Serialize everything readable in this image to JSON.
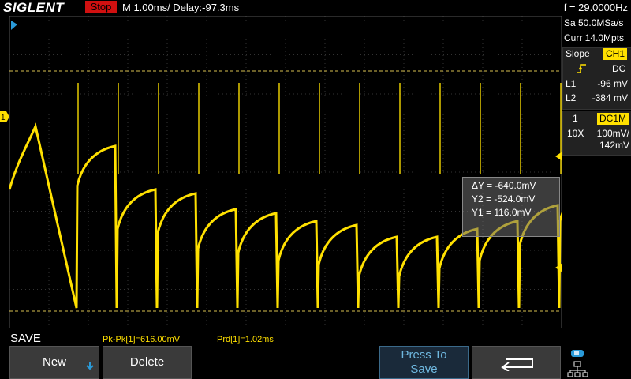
{
  "header": {
    "brand": "SIGLENT",
    "run_state": "Stop",
    "timebase": "M 1.00ms/ Delay:-97.3ms",
    "frequency": "f = 29.0000Hz"
  },
  "acquisition": {
    "sample_rate": "Sa 50.0MSa/s",
    "memory": "Curr 14.0Mpts"
  },
  "trigger": {
    "slope_label": "Slope",
    "source": "CH1",
    "coupling": "DC",
    "l1_label": "L1",
    "l1_value": "-96 mV",
    "l2_label": "L2",
    "l2_value": "-384 mV"
  },
  "channel": {
    "number": "1",
    "coupling_impedance": "DC1M",
    "probe": "10X",
    "volts_per_div": "100mV/",
    "offset": "142mV"
  },
  "cursors": {
    "delta_y": "ΔY = -640.0mV",
    "y2": "Y2 = -524.0mV",
    "y1": "Y1 = 116.0mV"
  },
  "measurements": {
    "pkpk": "Pk-Pk[1]=616.00mV",
    "period": "Prd[1]=1.02ms"
  },
  "menu": {
    "title": "SAVE",
    "new_label": "New",
    "delete_label": "Delete",
    "press_label_1": "Press To",
    "press_label_2": "Save"
  },
  "colors": {
    "trace": "#ffe000",
    "stop_bg": "#d01010",
    "accent_blue": "#2a9ad8"
  }
}
